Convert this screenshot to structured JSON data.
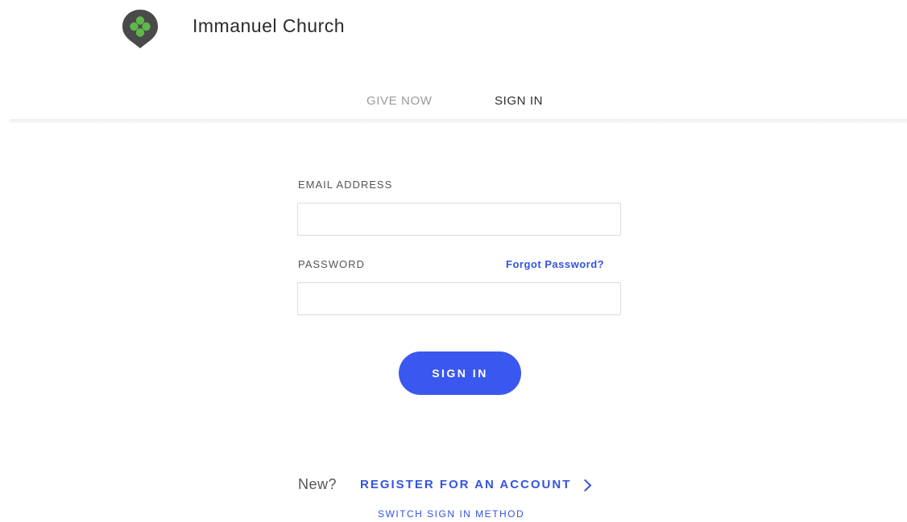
{
  "header": {
    "org_name": "Immanuel Church",
    "logo_icon": "clover-pin-icon",
    "logo_colors": {
      "pin": "#4a4a4a",
      "leaves": "#5fb84a"
    }
  },
  "nav": {
    "give_now": "GIVE NOW",
    "sign_in": "SIGN IN"
  },
  "form": {
    "email_label": "EMAIL ADDRESS",
    "email_value": "",
    "password_label": "PASSWORD",
    "password_value": "",
    "forgot_password": "Forgot Password?",
    "submit_label": "SIGN IN"
  },
  "footer": {
    "new_text": "New?",
    "register_label": "REGISTER FOR AN ACCOUNT",
    "switch_label": "SWITCH SIGN IN METHOD"
  },
  "colors": {
    "accent": "#3a57f0",
    "link": "#3354e0"
  }
}
